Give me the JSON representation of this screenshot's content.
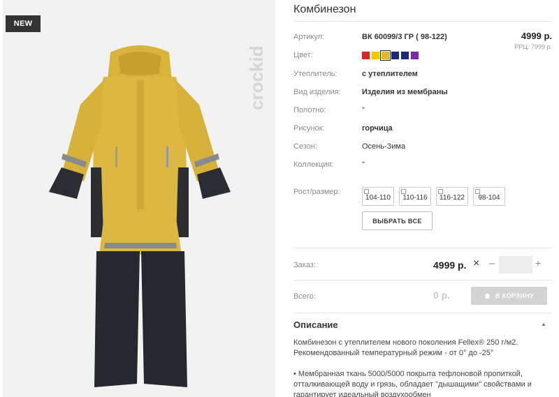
{
  "badge": "NEW",
  "brand": "crockid",
  "product": {
    "title": "Комбинезон",
    "price": "4999 р.",
    "rrp": "РРЦ: 7999 р."
  },
  "specs": {
    "article": {
      "label": "Артикул:",
      "value": "ВК 60099/3 ГР ( 98-122)"
    },
    "color": {
      "label": "Цвет:"
    },
    "insulation": {
      "label": "Утеплитель:",
      "value": "с утеплителем"
    },
    "type": {
      "label": "Вид изделия:",
      "value": "Изделия из мембраны"
    },
    "fabric": {
      "label": "Полотно:",
      "value": "\""
    },
    "pattern": {
      "label": "Рисунок:",
      "value": "горчица"
    },
    "season": {
      "label": "Сезон:",
      "value": "Осень-Зима"
    },
    "collection": {
      "label": "Коллекция:",
      "value": "\""
    }
  },
  "swatches": [
    "#d8262f",
    "#f5c400",
    "#e0ba2a",
    "#1c2a7a",
    "#1d2775",
    "#7d2aa8"
  ],
  "selected_swatch": 2,
  "sizes": {
    "label": "Рост/размер:",
    "options": [
      "104-110",
      "110-116",
      "116-122",
      "98-104"
    ],
    "select_all": "ВЫБРАТЬ ВСЕ"
  },
  "order": {
    "label": "Заказ:",
    "price": "4999 р.",
    "remove_icon": "close-icon",
    "minus": "–",
    "plus": "+",
    "quantity": ""
  },
  "total": {
    "label": "Всего:",
    "value": "0 р.",
    "cart_button": "В КОРЗИНУ"
  },
  "description": {
    "title": "Описание",
    "paragraph1": "Комбинезон с утеплителем нового поколения Fellex® 250 г/м2. Рекомендованный температурный режим - от 0° до -25°",
    "paragraph2": "• Мембранная ткань 5000/5000 покрыта тефлоновой пропиткой, отталкивающей воду и грязь, обладает \"дышащими\" свойствами и гарантирует идеальный воздухообмен"
  }
}
